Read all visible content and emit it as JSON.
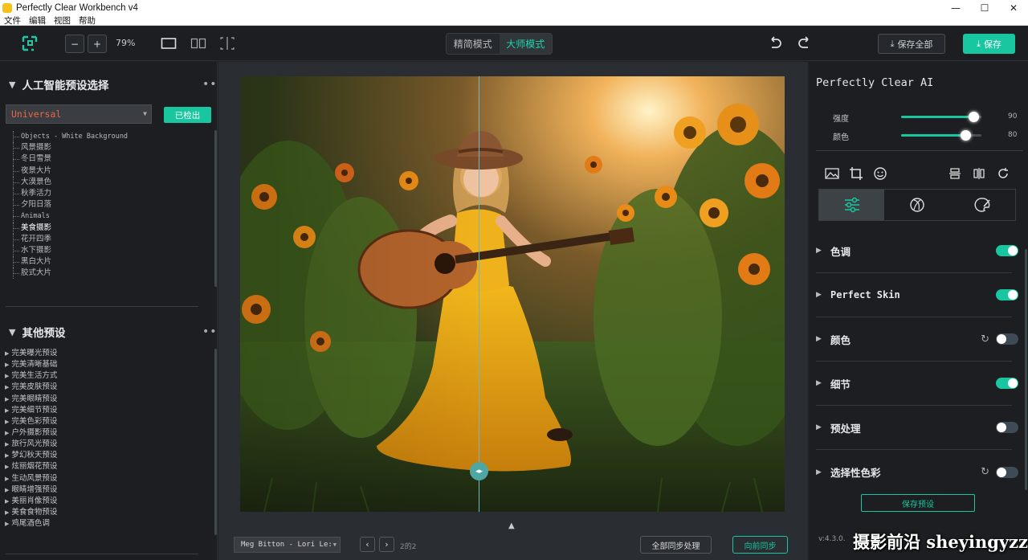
{
  "titlebar": {
    "title": "Perfectly Clear Workbench v4",
    "minimize": "—",
    "maximize": "☐",
    "close": "✕"
  },
  "menu": {
    "items": [
      "文件",
      "编辑",
      "视图",
      "帮助"
    ]
  },
  "toolbar": {
    "zoom_out": "−",
    "zoom_in": "+",
    "zoom": "79%",
    "mode_simple": "精简模式",
    "mode_master": "大师模式",
    "save_all": "保存全部",
    "save": "保存"
  },
  "left": {
    "ai_title": "人工智能预设选择",
    "more": "•••",
    "selected_preset": "Universal",
    "detected_label": "已检出",
    "ai_tree": [
      "Objects - White Background",
      "风景摄影",
      "冬日雪景",
      "夜景大片",
      "大漠景色",
      "秋季活力",
      "夕阳日落",
      "Animals",
      "美食摄影",
      "花开四季",
      "水下摄影",
      "黑白大片",
      "胶式大片"
    ],
    "other_title": "其他预设",
    "other_list": [
      "完美曝光预设",
      "完美清晰基础",
      "完美生活方式",
      "完美皮肤预设",
      "完美眼睛预设",
      "完美细节预设",
      "完美色彩预设",
      "户外摄影预设",
      "旅行风光预设",
      "梦幻秋天预设",
      "炫丽烟花预设",
      "生动风景预设",
      "眼睛增强预设",
      "美丽肖像预设",
      "美食食物预设",
      "鸡尾酒色调"
    ]
  },
  "center": {
    "image_name": "Meg Bitton - Lori Le:",
    "page": "2的2",
    "sync_all": "全部同步处理",
    "sync_prev": "向前同步",
    "handle": "◂▸"
  },
  "right": {
    "title": "Perfectly Clear AI",
    "sliders": [
      {
        "label": "强度",
        "value": "90",
        "fraction": 0.9
      },
      {
        "label": "颜色",
        "value": "80",
        "fraction": 0.8
      }
    ],
    "adjustments": [
      {
        "label": "色调",
        "on": true,
        "reset": false
      },
      {
        "label": "Perfect Skin",
        "on": true,
        "reset": false
      },
      {
        "label": "颜色",
        "on": false,
        "reset": true
      },
      {
        "label": "细节",
        "on": true,
        "reset": false
      },
      {
        "label": "预处理",
        "on": false,
        "reset": false
      },
      {
        "label": "选择性色彩",
        "on": false,
        "reset": true
      }
    ],
    "save_preset": "保存预设",
    "version": "v:4.3.0.",
    "watermark": "摄影前沿 sheyingyzz.com"
  },
  "colors": {
    "accent": "#18c79f",
    "panel": "#1c1e21",
    "canvas": "#2a2d31"
  }
}
